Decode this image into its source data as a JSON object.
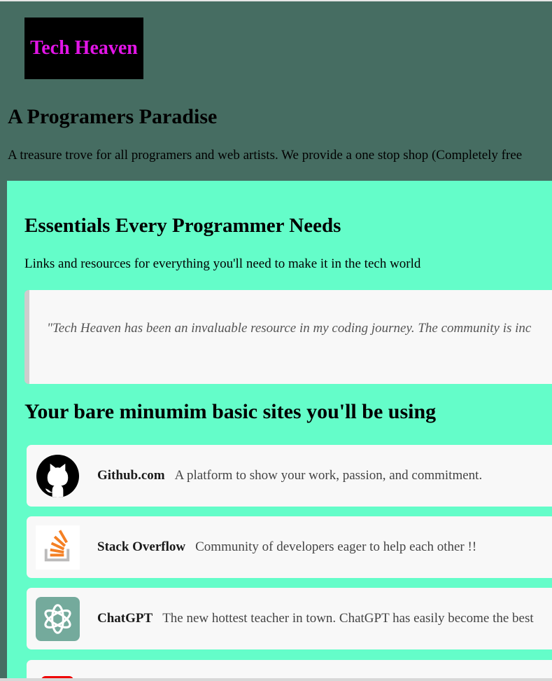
{
  "header": {
    "logo_text": "Tech Heaven",
    "title": "A Programers Paradise",
    "tagline": "A treasure trove for all programers and web artists. We provide a one stop shop (Completely free"
  },
  "essentials": {
    "title": "Essentials Every Programmer Needs",
    "subtitle": "Links and resources for everything you'll need to make it in the tech world",
    "quote": "\"Tech Heaven has been an invaluable resource in my coding journey. The community is inc"
  },
  "sites": {
    "title": "Your bare minumim basic sites you'll be using",
    "items": [
      {
        "name": "Github.com",
        "desc": "A platform to show your work, passion, and commitment.",
        "icon": "github-icon"
      },
      {
        "name": "Stack Overflow",
        "desc": "Community of developers eager to help each other !!",
        "icon": "stack-overflow-icon"
      },
      {
        "name": "ChatGPT",
        "desc": "The new hottest teacher in town. ChatGPT has easily become the best",
        "icon": "chatgpt-icon"
      },
      {
        "name": "",
        "desc": "",
        "icon": "youtube-icon"
      }
    ]
  },
  "colors": {
    "page_bg": "#466d62",
    "panel_bg": "#64fdc9",
    "logo_text": "#e215e6",
    "card_bg": "#f8f8f8"
  }
}
